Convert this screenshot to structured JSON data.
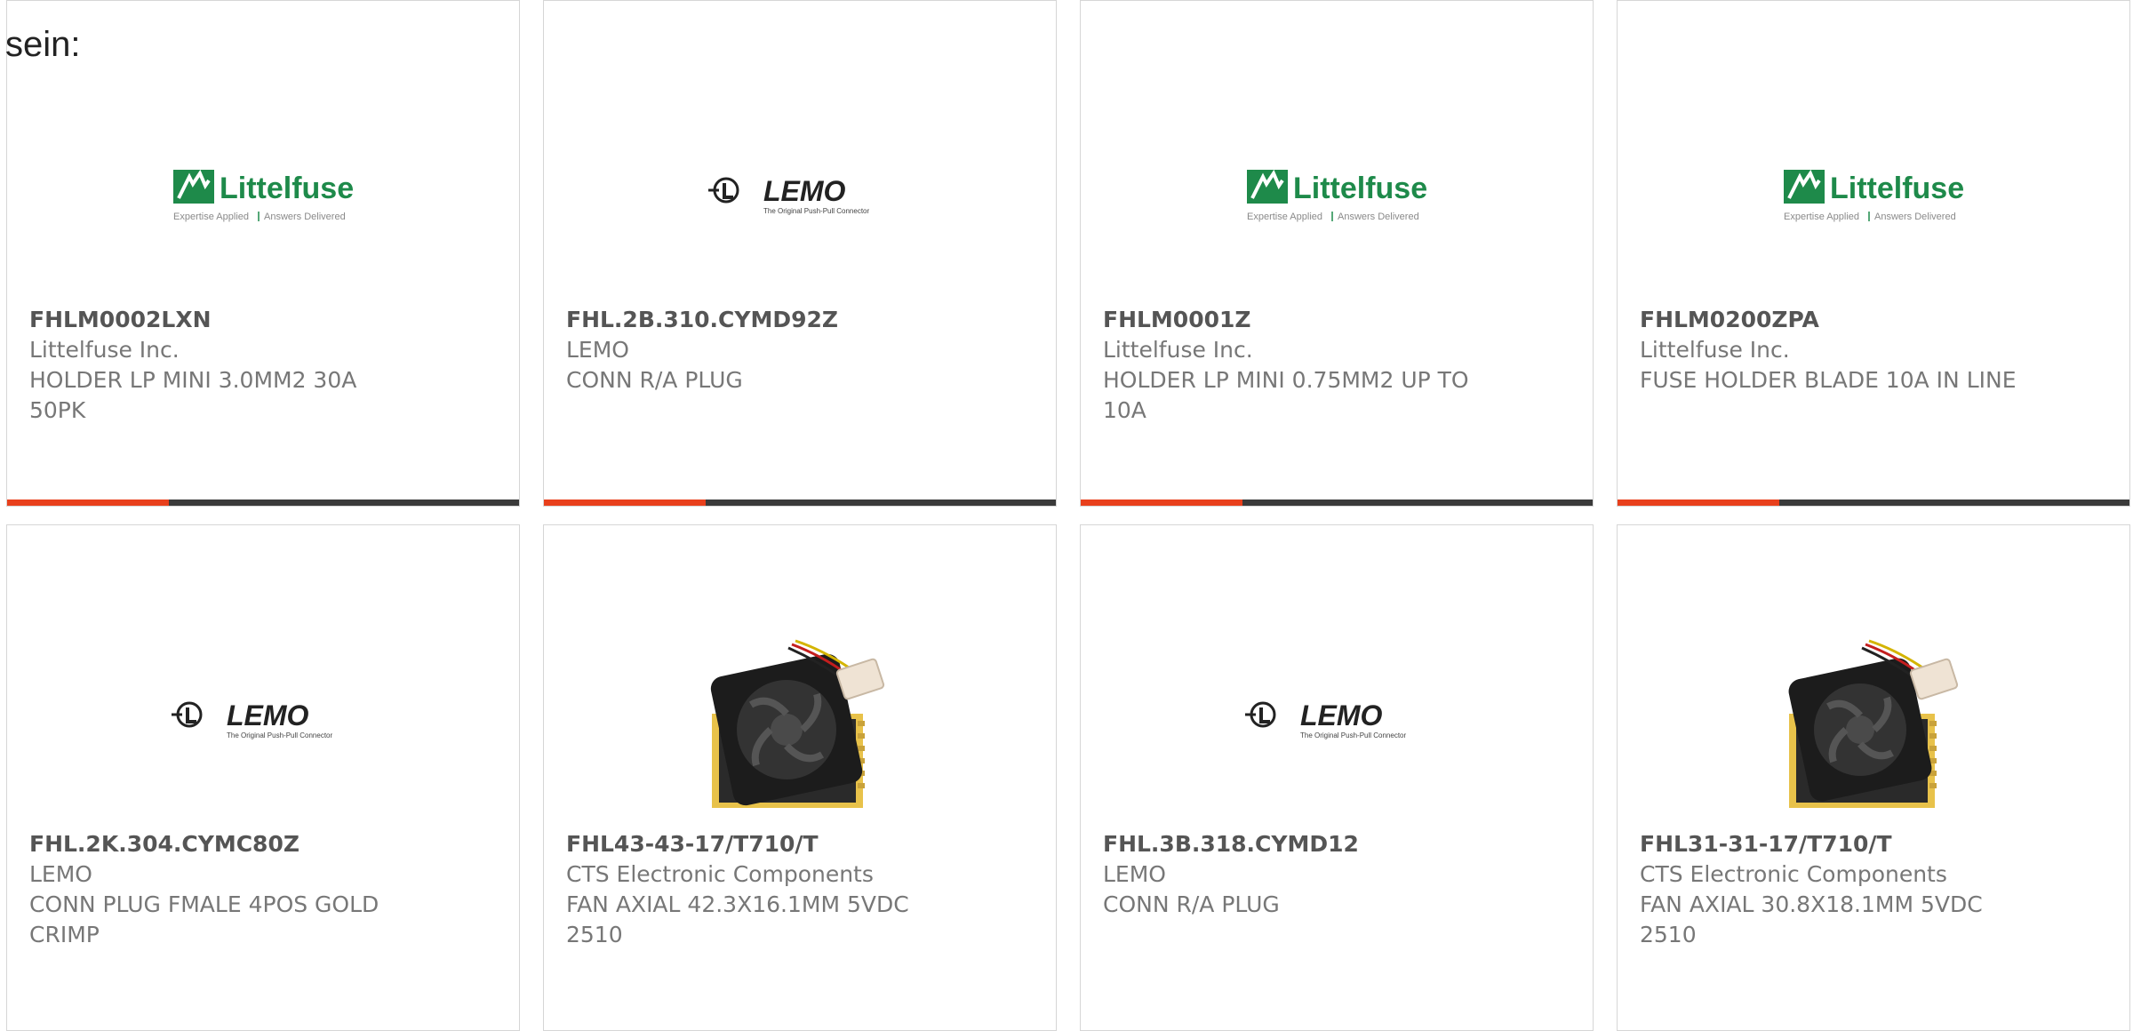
{
  "page": {
    "lead_text": "sein:"
  },
  "colors": {
    "accent_orange": "#e8401c",
    "bar_dark": "#3a3a3a",
    "littelfuse_green": "#1e8a4a",
    "text_grey": "#777777"
  },
  "logos": {
    "littelfuse": {
      "name": "Littelfuse",
      "tagline_left": "Expertise Applied",
      "tagline_right": "Answers Delivered"
    },
    "lemo": {
      "name": "LEMO",
      "tagline": "The Original Push-Pull Connector"
    }
  },
  "products": [
    {
      "part_number": "FHLM0002LXN",
      "manufacturer": "Littelfuse Inc.",
      "description": "HOLDER LP MINI 3.0MM2 30A 50PK",
      "image": "littelfuse-logo"
    },
    {
      "part_number": "FHL.2B.310.CYMD92Z",
      "manufacturer": "LEMO",
      "description": "CONN R/A PLUG",
      "image": "lemo-logo"
    },
    {
      "part_number": "FHLM0001Z",
      "manufacturer": "Littelfuse Inc.",
      "description": "HOLDER LP MINI 0.75MM2 UP TO 10A",
      "image": "littelfuse-logo"
    },
    {
      "part_number": "FHLM0200ZPA",
      "manufacturer": "Littelfuse Inc.",
      "description": "FUSE HOLDER BLADE 10A IN LINE",
      "image": "littelfuse-logo"
    },
    {
      "part_number": "FHL.2K.304.CYMC80Z",
      "manufacturer": "LEMO",
      "description": "CONN PLUG FMALE 4POS GOLD CRIMP",
      "image": "lemo-logo"
    },
    {
      "part_number": "FHL43-43-17/T710/T",
      "manufacturer": "CTS Electronic Components",
      "description": "FAN AXIAL 42.3X16.1MM 5VDC 2510",
      "image": "fan-photo"
    },
    {
      "part_number": "FHL.3B.318.CYMD12",
      "manufacturer": "LEMO",
      "description": "CONN R/A PLUG",
      "image": "lemo-logo"
    },
    {
      "part_number": "FHL31-31-17/T710/T",
      "manufacturer": "CTS Electronic Components",
      "description": "FAN AXIAL 30.8X18.1MM 5VDC 2510",
      "image": "fan-photo"
    }
  ]
}
